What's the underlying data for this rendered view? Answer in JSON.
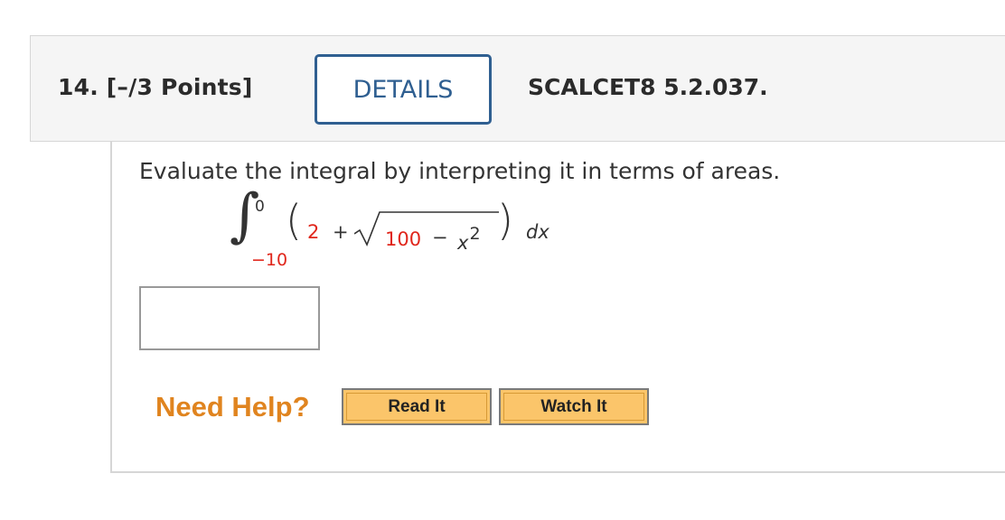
{
  "question": {
    "number_label": "14.  [–/3 Points]",
    "details_label": "DETAILS",
    "source_code": "SCALCET8 5.2.037."
  },
  "problem": {
    "prompt": "Evaluate the integral by interpreting it in terms of areas.",
    "integral": {
      "upper_limit": "0",
      "lower_limit": "−10",
      "constant": "2",
      "plus": "+",
      "radicand_constant": "100",
      "minus": "−",
      "variable": "x",
      "exponent": "2",
      "differential": "dx"
    },
    "answer": {
      "value": "",
      "placeholder": ""
    }
  },
  "help": {
    "label": "Need Help?",
    "read_it_label": "Read It",
    "watch_it_label": "Watch It"
  },
  "colors": {
    "accent_blue": "#2f5f91",
    "help_orange": "#e0841f",
    "highlight_red": "#e0261b",
    "button_gold": "#fbc56a"
  }
}
